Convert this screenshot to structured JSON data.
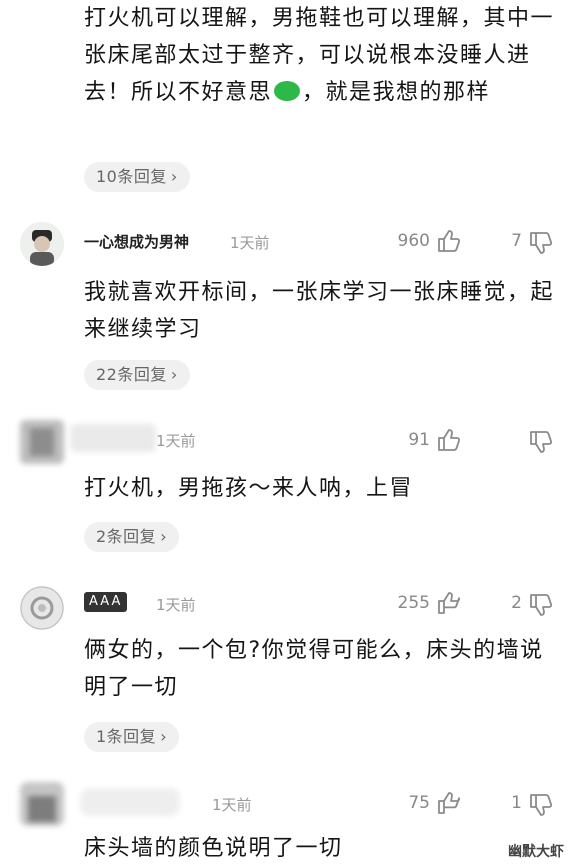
{
  "comments": [
    {
      "text": "打火机可以理解，男拖鞋也可以理解，其中一张床尾部太过于整齐，可以说根本没睡人进去！所以不好意思",
      "text_suffix": "，就是我想的那样",
      "emoji": "green-face-icon",
      "replies": "10条回复"
    },
    {
      "name": "一心想成为男神",
      "time": "1天前",
      "likes": "960",
      "dislikes": "7",
      "text": "我就喜欢开标间，一张床学习一张床睡觉，起来继续学习",
      "replies": "22条回复"
    },
    {
      "name": "",
      "time": "1天前",
      "likes": "91",
      "dislikes": "",
      "text": "打火机，男拖孩～来人呐，上冒",
      "replies": "2条回复"
    },
    {
      "name": "AAA",
      "time": "1天前",
      "likes": "255",
      "dislikes": "2",
      "text": "俩女的，一个包?你觉得可能么，床头的墙说明了一切",
      "replies": "1条回复"
    },
    {
      "name": "",
      "time": "1天前",
      "likes": "75",
      "dislikes": "1",
      "text": "床头墙的颜色说明了一切"
    }
  ],
  "watermark": "幽默大虾",
  "colors": {
    "accent_emoji": "#2fb84a",
    "pill_bg": "#f0f0f0",
    "meta_gray": "#9a9a9a"
  }
}
